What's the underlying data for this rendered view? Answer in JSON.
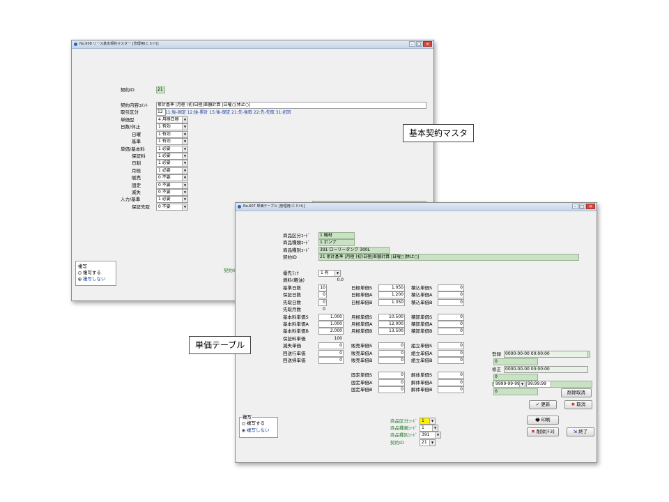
{
  "master": {
    "title": "No.608 リース基本契約マスター [管理用(ＣＳＨ)]",
    "contract_id_label": "契約ID",
    "contract_id": "21",
    "comment_label": "契約内容ｺﾒﾝﾄ",
    "comment": "累計基準 |月極 (初)日極|差額計算 |日曜○|休止○|",
    "torihiki_label": "取引区分",
    "torihiki_value": "12",
    "torihiki_options": "11:後-固定 12:後-累計 15:後-保証 21:先-後取 22:先-先取 31:初回",
    "rows": [
      {
        "label": "単価型",
        "value": "4 月極日極"
      },
      {
        "label": "日数/休止",
        "value": "1 有効"
      },
      {
        "label": "日曜",
        "value": "1 有効"
      },
      {
        "label": "基準",
        "value": "1 有効"
      },
      {
        "label": "単価/基本料",
        "value": "1 必要"
      },
      {
        "label": "保証料",
        "value": "1 必要"
      },
      {
        "label": "日割",
        "value": "1 必要"
      },
      {
        "label": "月極",
        "value": "1 必要"
      },
      {
        "label": "販売",
        "value": "0 不要"
      },
      {
        "label": "固定",
        "value": "0 不要"
      },
      {
        "label": "滅失",
        "value": "0 不要"
      },
      {
        "label": "入力/基準",
        "value": "1 必要"
      },
      {
        "label": "保証先取",
        "value": "0 不要"
      }
    ],
    "fukusha_title": "複写",
    "fukusha_yes": "複写する",
    "fukusha_no": "複写しない",
    "partial_label": "契約ID"
  },
  "callout_master": "基本契約マスタ",
  "callout_tanka": "単価テーブル",
  "tanka": {
    "title": "No.607 単価テーブル [管理用(ＣＳＨ)]",
    "header": [
      {
        "label": "商品区分ｺｰﾄﾞ",
        "value": "1 機材"
      },
      {
        "label": "商品種類ｺｰﾄﾞ",
        "value": "1 ポンプ"
      },
      {
        "label": "商品種別ｺｰﾄﾞ",
        "value": "391 ローリータンク 300L"
      },
      {
        "label": "契約ID",
        "value": "21 累計基準 |月極 (初)日極|差額計算 |日曜○|休止○|"
      }
    ],
    "priority_label": "優先ﾗﾝｸ",
    "priority_value": "1 有",
    "fuel_label": "燃料(軽油)",
    "fuel_value": "0.0",
    "left_col": [
      {
        "label": "基準日数",
        "value": "10"
      },
      {
        "label": "保証日数",
        "value": "0"
      },
      {
        "label": "先取日数",
        "value": "0"
      },
      {
        "label": "先取月数",
        "value": "0"
      },
      {
        "label": "基本料単価S",
        "value": "1.000"
      },
      {
        "label": "基本料単価A",
        "value": "1.000"
      },
      {
        "label": "基本料単価B",
        "value": "2.000"
      },
      {
        "label": "保証料単価",
        "value": "100"
      },
      {
        "label": "滅失単価",
        "value": "0"
      },
      {
        "label": "回送行単価",
        "value": "0"
      },
      {
        "label": "回送帰単価",
        "value": "0"
      }
    ],
    "mid_top": [
      {
        "label": "日極単価S",
        "value": "1.050"
      },
      {
        "label": "日極単価A",
        "value": "1.200"
      },
      {
        "label": "日極単価B",
        "value": "1.350"
      }
    ],
    "mid_month": [
      {
        "label": "月極単価S",
        "value": "10.500"
      },
      {
        "label": "月極単価A",
        "value": "12.000"
      },
      {
        "label": "月極単価B",
        "value": "13.500"
      }
    ],
    "mid_sales": [
      {
        "label": "販売単価S",
        "value": "0"
      },
      {
        "label": "販売単価A",
        "value": "0"
      },
      {
        "label": "販売単価B",
        "value": "0"
      }
    ],
    "mid_fixed": [
      {
        "label": "固定単価S",
        "value": "0"
      },
      {
        "label": "固定単価A",
        "value": "0"
      },
      {
        "label": "固定単価B",
        "value": "0"
      }
    ],
    "right_top": [
      {
        "label": "積込単価S",
        "value": "0"
      },
      {
        "label": "積込単価A",
        "value": "0"
      },
      {
        "label": "積込単価B",
        "value": "0"
      }
    ],
    "right_unload": [
      {
        "label": "積卸単価S",
        "value": "0"
      },
      {
        "label": "積卸単価A",
        "value": "0"
      },
      {
        "label": "積卸単価B",
        "value": "0"
      }
    ],
    "right_assemble": [
      {
        "label": "組立単価S",
        "value": "0"
      },
      {
        "label": "組立単価A",
        "value": "0"
      },
      {
        "label": "組立単価B",
        "value": "0"
      }
    ],
    "right_dismantle": [
      {
        "label": "解体単価S",
        "value": "0"
      },
      {
        "label": "解体単価A",
        "value": "0"
      },
      {
        "label": "解体単価B",
        "value": "0"
      }
    ],
    "reg_label": "登録",
    "reg_value": "0000-00-00 00:00:00",
    "reg_sub": "0",
    "mod_label": "修正",
    "mod_value": "0000-00-00 00:00:00",
    "mod_sub": "0",
    "del_label": "削除",
    "del_date": "9999-99-99",
    "del_time": "99:99:99",
    "del_sub": "0",
    "del_cancel": "削除取消",
    "update_btn": "更新",
    "cancel_btn": "取消",
    "print_btn": "印刷",
    "delete_btn": "削除[F3]",
    "end_btn": "終了",
    "fukusha_title": "複写",
    "fukusha_yes": "複写する",
    "fukusha_no": "複写しない",
    "search": [
      {
        "label": "商品区分ｺｰﾄﾞ",
        "value": "1"
      },
      {
        "label": "商品種類ｺｰﾄﾞ",
        "value": "1"
      },
      {
        "label": "商品種別ｺｰﾄﾞ",
        "value": "391"
      },
      {
        "label": "契約ID",
        "value": "21"
      }
    ]
  }
}
